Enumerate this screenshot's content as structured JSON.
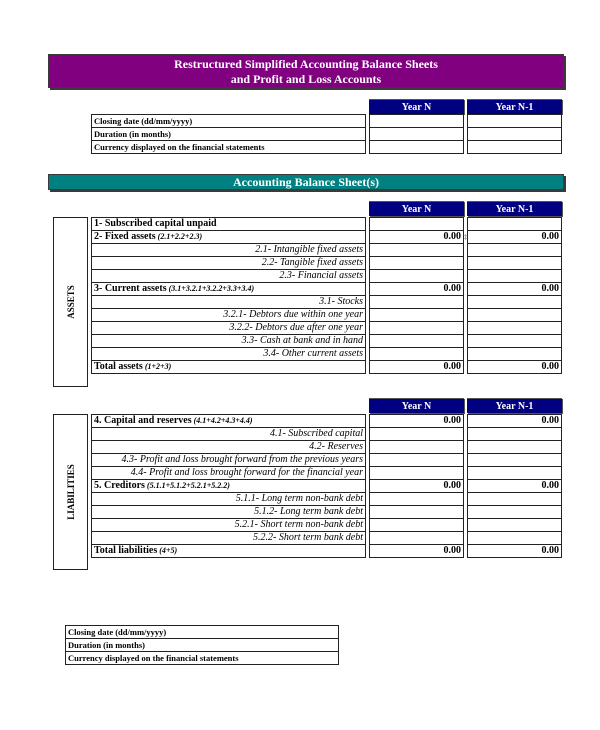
{
  "header": {
    "title_line1": "Restructured Simplified Accounting Balance Sheets",
    "title_line2": "and Profit and Loss Accounts"
  },
  "columns": {
    "year_n": "Year N",
    "year_n1": "Year N-1"
  },
  "info_table": {
    "rows": [
      "Closing date (dd/mm/yyyy)",
      "Duration (in months)",
      "Currency displayed on the financial statements"
    ]
  },
  "balance_sheet": {
    "title": "Accounting Balance Sheet(s)",
    "assets": {
      "label": "ASSETS",
      "rows": [
        {
          "text": "1- Subscribed capital unpaid",
          "formula": "",
          "type": "main",
          "year_n": "",
          "year_n1": ""
        },
        {
          "text": "2- Fixed assets",
          "formula": "(2.1+2.2+2.3)",
          "type": "main",
          "year_n": "0.00",
          "year_n1": "0.00"
        },
        {
          "text": "2.1- Intangible fixed assets",
          "formula": "",
          "type": "sub",
          "year_n": "",
          "year_n1": ""
        },
        {
          "text": "2.2- Tangible fixed assets",
          "formula": "",
          "type": "sub",
          "year_n": "",
          "year_n1": ""
        },
        {
          "text": "2.3- Financial assets",
          "formula": "",
          "type": "sub",
          "year_n": "",
          "year_n1": ""
        },
        {
          "text": "3- Current assets",
          "formula": "(3.1+3.2.1+3.2.2+3.3+3.4)",
          "type": "main",
          "year_n": "0.00",
          "year_n1": "0.00"
        },
        {
          "text": "3.1- Stocks",
          "formula": "",
          "type": "sub",
          "year_n": "",
          "year_n1": ""
        },
        {
          "text": "3.2.1- Debtors due within one year",
          "formula": "",
          "type": "sub",
          "year_n": "",
          "year_n1": ""
        },
        {
          "text": "3.2.2- Debtors due after one year",
          "formula": "",
          "type": "sub",
          "year_n": "",
          "year_n1": ""
        },
        {
          "text": "3.3- Cash at bank and in hand",
          "formula": "",
          "type": "sub",
          "year_n": "",
          "year_n1": ""
        },
        {
          "text": "3.4- Other current assets",
          "formula": "",
          "type": "sub",
          "year_n": "",
          "year_n1": ""
        },
        {
          "text": "Total assets",
          "formula": "(1+2+3)",
          "type": "main",
          "year_n": "0.00",
          "year_n1": "0.00"
        }
      ]
    },
    "liabilities": {
      "label": "LIABILITIES",
      "rows": [
        {
          "text": "4. Capital and reserves",
          "formula": "(4.1+4.2+4.3+4.4)",
          "type": "main",
          "year_n": "0.00",
          "year_n1": "0.00"
        },
        {
          "text": "4.1- Subscribed capital",
          "formula": "",
          "type": "sub",
          "year_n": "",
          "year_n1": ""
        },
        {
          "text": "4.2- Reserves",
          "formula": "",
          "type": "sub",
          "year_n": "",
          "year_n1": ""
        },
        {
          "text": "4.3- Profit and loss brought forward from the previous years",
          "formula": "",
          "type": "sub",
          "year_n": "",
          "year_n1": ""
        },
        {
          "text": "4.4- Profit and loss brought forward for the financial year",
          "formula": "",
          "type": "sub",
          "year_n": "",
          "year_n1": ""
        },
        {
          "text": "5. Creditors",
          "formula": "(5.1.1+5.1.2+5.2.1+5.2.2)",
          "type": "main",
          "year_n": "0.00",
          "year_n1": "0.00"
        },
        {
          "text": "5.1.1- Long term non-bank debt",
          "formula": "",
          "type": "sub",
          "year_n": "",
          "year_n1": ""
        },
        {
          "text": "5.1.2- Long term bank debt",
          "formula": "",
          "type": "sub",
          "year_n": "",
          "year_n1": ""
        },
        {
          "text": "5.2.1- Short term non-bank debt",
          "formula": "",
          "type": "sub",
          "year_n": "",
          "year_n1": ""
        },
        {
          "text": "5.2.2- Short term bank debt",
          "formula": "",
          "type": "sub",
          "year_n": "",
          "year_n1": ""
        },
        {
          "text": "Total liabilities",
          "formula": "(4+5)",
          "type": "main",
          "year_n": "0.00",
          "year_n1": "0.00"
        }
      ]
    }
  },
  "footer_table": {
    "rows": [
      "Closing date (dd/mm/yyyy)",
      "Duration (in months)",
      "Currency displayed on the financial statements"
    ]
  },
  "colors": {
    "title_banner": "#800080",
    "section_banner": "#008080",
    "column_header": "#000080"
  }
}
